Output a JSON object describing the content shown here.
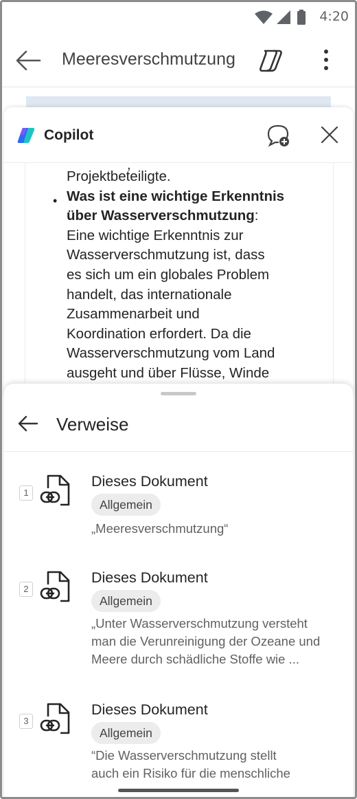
{
  "status_bar": {
    "time": "4:20",
    "icons": [
      "wifi-icon",
      "signal-icon",
      "battery-icon"
    ]
  },
  "app_bar": {
    "title": "Meeresverschmutzung",
    "icons": [
      "back-arrow-icon",
      "copilot-icon",
      "more-vert-icon"
    ]
  },
  "copilot": {
    "title": "Copilot",
    "icons": [
      "copilot-logo-icon",
      "new-chat-icon",
      "close-icon"
    ],
    "truncated_line": ",",
    "lines": [
      "Projektbeteiligte.",
      "Was ist eine wichtige Erkenntnis",
      "über Wasserverschmutzung",
      ":",
      "Eine wichtige Erkenntnis zur",
      "Wasserverschmutzung ist, dass",
      "es sich um ein globales Problem",
      "handelt, das internationale",
      "Zusammenarbeit und",
      "Koordination erfordert. Da die",
      "Wasserverschmutzung vom Land",
      "ausgeht und über Flüsse, Winde"
    ]
  },
  "references": {
    "title": "Verweise",
    "items": [
      {
        "num": "1",
        "title": "Dieses Dokument",
        "badge": "Allgemein",
        "quote": [
          "„Meeresverschmutzung“"
        ]
      },
      {
        "num": "2",
        "title": "Dieses Dokument",
        "badge": "Allgemein",
        "quote": [
          "„Unter Wasserverschmutzung versteht",
          "man die Verunreinigung der Ozeane und",
          "Meere durch schädliche Stoffe wie ..."
        ]
      },
      {
        "num": "3",
        "title": "Dieses Dokument",
        "badge": "Allgemein",
        "quote": [
          "“Die Wasserverschmutzung stellt",
          "auch ein Risiko für die menschliche"
        ]
      }
    ]
  },
  "colors": {
    "copilot_blue": "#2b6cf0",
    "copilot_teal": "#1fc2c2",
    "text": "#242424",
    "muted": "#616161"
  }
}
